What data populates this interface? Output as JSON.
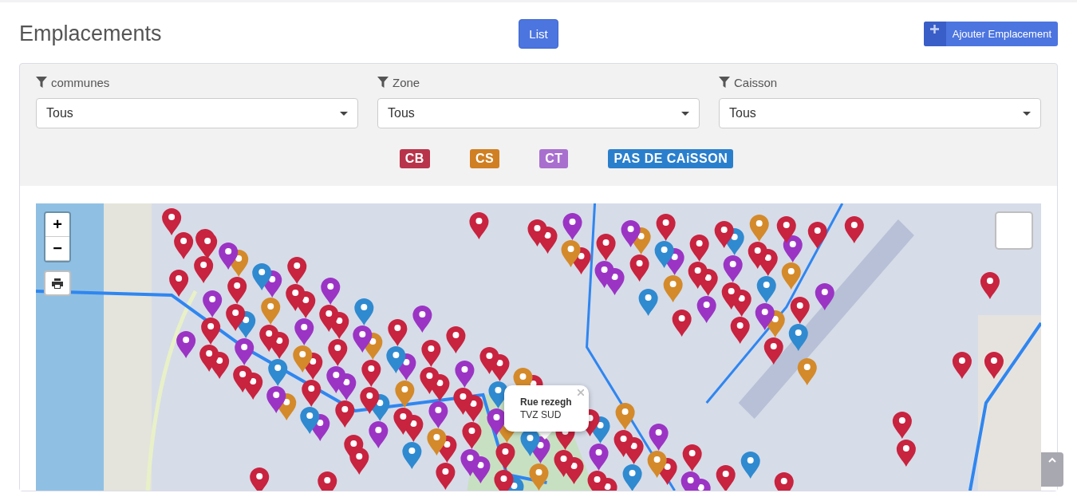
{
  "page": {
    "title": "Emplacements",
    "list_button": "List",
    "add_button": "Ajouter Emplacement"
  },
  "filters": [
    {
      "label": "communes",
      "value": "Tous"
    },
    {
      "label": "Zone",
      "value": "Tous"
    },
    {
      "label": "Caisson",
      "value": "Tous"
    }
  ],
  "legend": [
    {
      "label": "CB",
      "color": "#b8344a"
    },
    {
      "label": "CS",
      "color": "#d07f22"
    },
    {
      "label": "CT",
      "color": "#a86fcf"
    },
    {
      "label": "PAS DE CAiSSON",
      "color": "#2a7fcd"
    }
  ],
  "map": {
    "zoom_in": "+",
    "zoom_out": "−",
    "popup": {
      "title": "Rue rezegh",
      "subtitle": "TVZ SUD"
    }
  }
}
